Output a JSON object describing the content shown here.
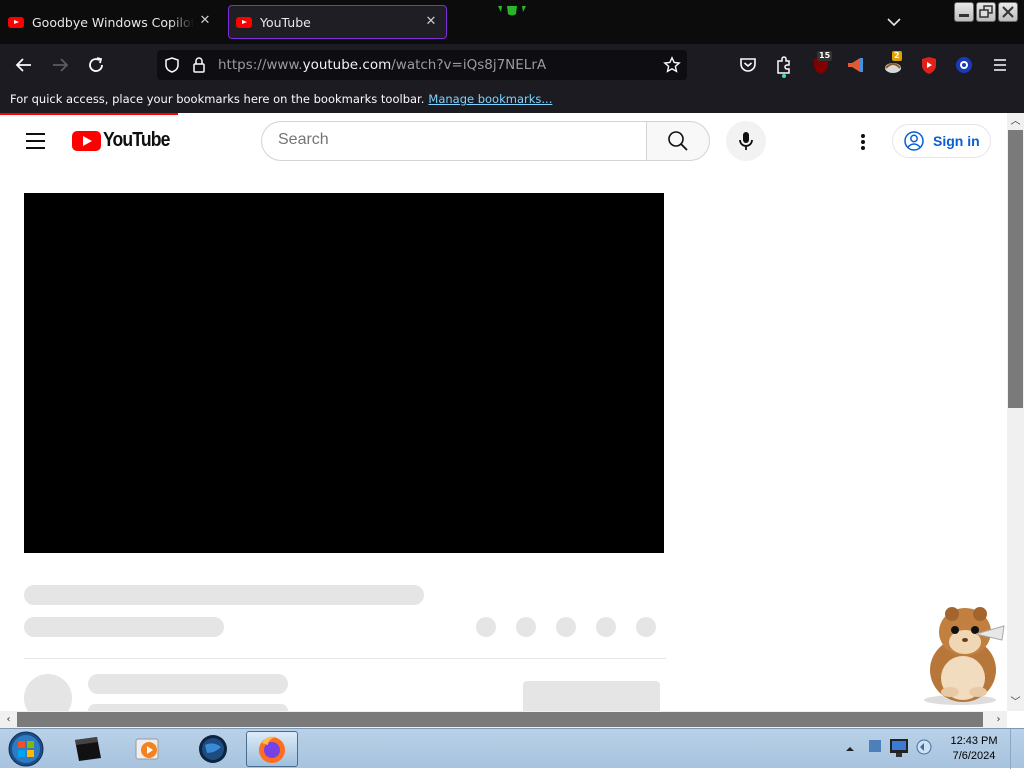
{
  "browser": {
    "tabs": [
      {
        "title": "Goodbye Windows Copilot (Ap",
        "active": false
      },
      {
        "title": "YouTube",
        "active": true
      }
    ],
    "url": {
      "prefix": "https://www.",
      "domain": "youtube.com",
      "path": "/watch?v=iQs8j7NELrA"
    },
    "extensions": [
      {
        "icon": "ublock-icon",
        "badge": "15"
      },
      {
        "icon": "megaphone-extension-icon",
        "badge": ""
      },
      {
        "icon": "hamster-extension-icon",
        "badge": "2"
      },
      {
        "icon": "youtube-extension-icon",
        "badge": ""
      },
      {
        "icon": "blue-circle-extension-icon",
        "badge": ""
      }
    ],
    "bookmarks_bar": {
      "message": "For quick access, place your bookmarks here on the bookmarks toolbar.",
      "link": "Manage bookmarks..."
    }
  },
  "youtube": {
    "logo_text": "YouTube",
    "search": {
      "placeholder": "Search",
      "value": ""
    },
    "sign_in_label": "Sign in",
    "video": {
      "id": "iQs8j7NELrA",
      "state": "loading"
    }
  },
  "taskbar": {
    "clock_time": "12:43 PM",
    "clock_date": "7/6/2024",
    "pinned": [
      "media-icon",
      "vlc-icon",
      "globe-icon",
      "firefox-icon"
    ]
  },
  "colors": {
    "accent_purple": "#7d2ed8",
    "youtube_red": "#ff0000",
    "signin_blue": "#065fd4",
    "chrome_dark": "#1c1b22",
    "tabstrip_dark": "#0c0c0d"
  }
}
